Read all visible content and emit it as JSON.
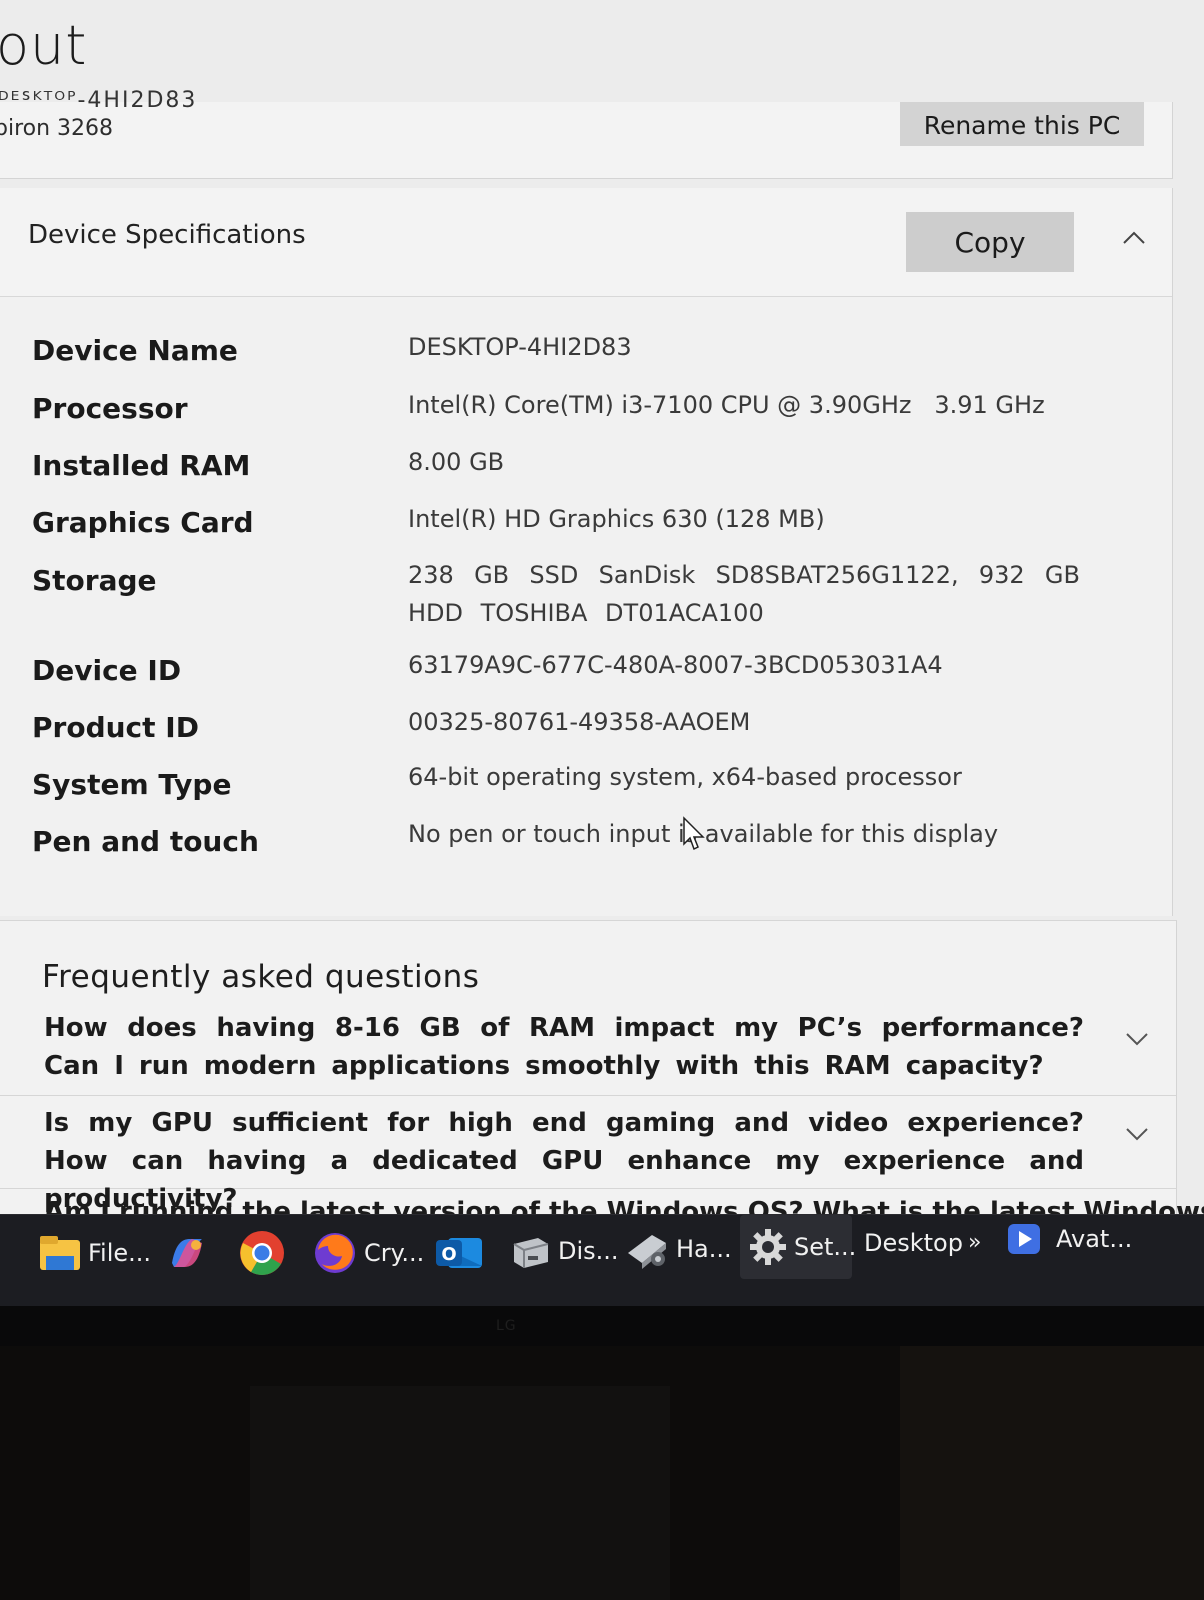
{
  "page": {
    "title": "out",
    "device_name_cut": "ᴰᴱᔆᴷᵀᴼᴾ-4HI2D83",
    "model": "piron 3268",
    "rename_label": "Rename this PC"
  },
  "specs": {
    "header": "Device Specifications",
    "copy_label": "Copy",
    "rows": [
      {
        "label": "Device Name",
        "value": "DESKTOP-4HI2D83"
      },
      {
        "label": "Processor",
        "value": "Intel(R) Core(TM) i3-7100 CPU @ 3.90GHz   3.91 GHz"
      },
      {
        "label": "Installed RAM",
        "value": "8.00 GB"
      },
      {
        "label": "Graphics Card",
        "value": "Intel(R) HD Graphics 630 (128 MB)"
      },
      {
        "label": "Storage",
        "value": "238 GB SSD SanDisk SD8SBAT256G1122, 932 GB HDD TOSHIBA DT01ACA100"
      },
      {
        "label": "Device ID",
        "value": "63179A9C-677C-480A-8007-3BCD053031A4"
      },
      {
        "label": "Product ID",
        "value": "00325-80761-49358-AAOEM"
      },
      {
        "label": "System Type",
        "value": "64-bit operating system, x64-based processor"
      },
      {
        "label": "Pen and touch",
        "value": "No pen or touch input is available for this display"
      }
    ]
  },
  "faq": {
    "title": "Frequently asked questions",
    "items": [
      {
        "question": "How does having 8-16 GB of RAM impact my PC’s performance? Can I run modern applications smoothly with this RAM capacity?"
      },
      {
        "question": "Is my GPU sufficient for high end gaming and video experience? How can having a dedicated GPU enhance my experience and productivity?"
      }
    ],
    "partial_question": "Am I running the latest version of the Windows OS? What is the latest Windows"
  },
  "taskbar": {
    "items": [
      {
        "label": "File...",
        "icon": "file-explorer-icon"
      },
      {
        "label": "",
        "icon": "copilot-icon"
      },
      {
        "label": "",
        "icon": "chrome-icon"
      },
      {
        "label": "Cry...",
        "icon": "firefox-icon"
      },
      {
        "label": "",
        "icon": "outlook-icon"
      },
      {
        "label": "Dis...",
        "icon": "disk-management-icon"
      },
      {
        "label": "Ha...",
        "icon": "hardware-icon"
      },
      {
        "label": "Set...",
        "icon": "settings-gear-icon"
      },
      {
        "label": "Desktop",
        "icon": ""
      },
      {
        "label": "Avat...",
        "icon": "media-play-icon"
      }
    ],
    "overflow": "»"
  },
  "monitor": {
    "brand": "LG"
  },
  "colors": {
    "screen_bg": "#ececec",
    "card_bg": "#f1f1f1",
    "button_bg": "#cdcdcd",
    "taskbar_bg": "#1c1d22"
  }
}
